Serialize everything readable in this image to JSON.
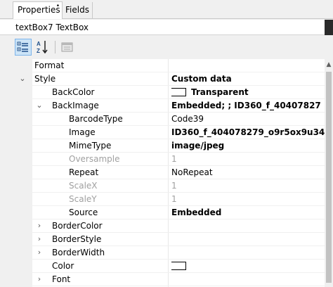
{
  "tabs": [
    {
      "label": "Properties",
      "dot": "•"
    },
    {
      "label": "Fields"
    }
  ],
  "object_selector": {
    "value": "textBox7 TextBox"
  },
  "toolbar": {
    "categorized_icon": "categorized-icon",
    "alphabetical_icon": "sort-alphabetical-icon",
    "property_pages_icon": "property-pages-icon"
  },
  "grid": {
    "rows": [
      {
        "name": "Format",
        "value": ""
      },
      {
        "name": "Style",
        "value": "Custom data",
        "expander": "⌄"
      },
      {
        "name": "BackColor",
        "value": "Transparent",
        "swatch": true
      },
      {
        "name": "BackImage",
        "value": "Embedded; ; ID360_f_40407827",
        "expander": "⌄"
      },
      {
        "name": "BarcodeType",
        "value": "Code39"
      },
      {
        "name": "Image",
        "value": "ID360_f_404078279_o9r5ox9u34"
      },
      {
        "name": "MimeType",
        "value": "image/jpeg"
      },
      {
        "name": "Oversample",
        "value": "1"
      },
      {
        "name": "Repeat",
        "value": "NoRepeat"
      },
      {
        "name": "ScaleX",
        "value": "1"
      },
      {
        "name": "ScaleY",
        "value": "1"
      },
      {
        "name": "Source",
        "value": "Embedded"
      },
      {
        "name": "BorderColor",
        "value": "",
        "expander": "›"
      },
      {
        "name": "BorderStyle",
        "value": "",
        "expander": "›"
      },
      {
        "name": "BorderWidth",
        "value": "",
        "expander": "›"
      },
      {
        "name": "Color",
        "value": "",
        "swatch": true
      },
      {
        "name": "Font",
        "value": "",
        "expander": "›"
      }
    ]
  },
  "scroll_up_glyph": "▲"
}
